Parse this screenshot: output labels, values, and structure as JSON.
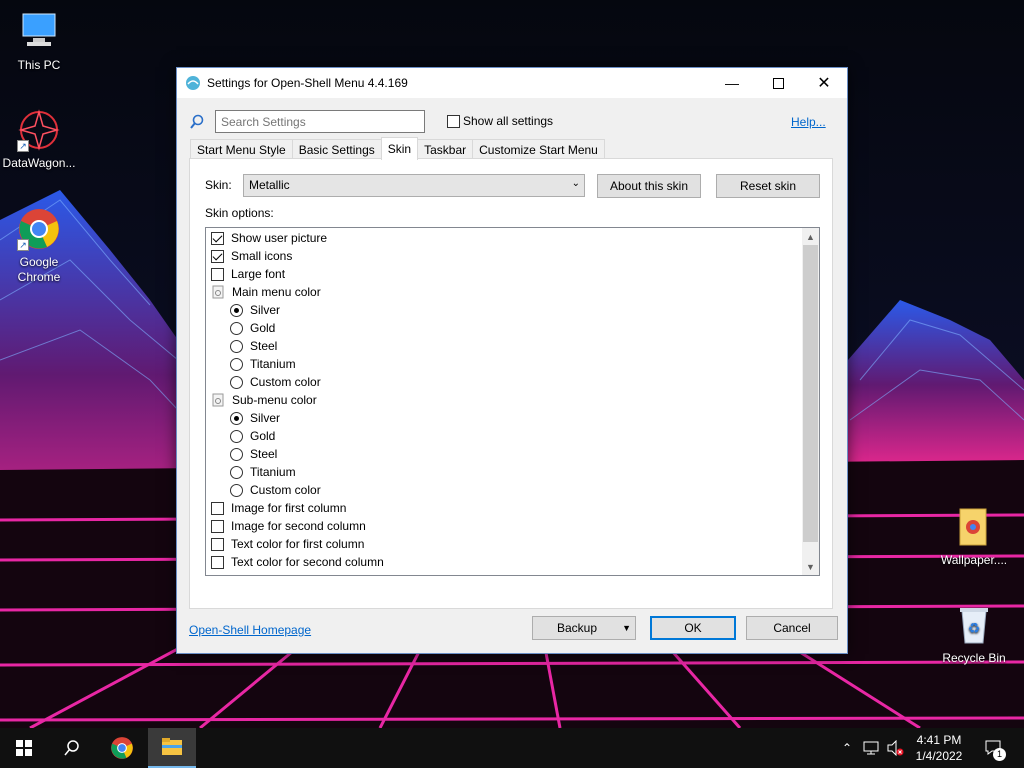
{
  "desktop": {
    "icons": [
      {
        "label": "This PC"
      },
      {
        "label": "DataWagon..."
      },
      {
        "label": "Google Chrome"
      },
      {
        "label": "Wallpaper...."
      },
      {
        "label": "Recycle Bin"
      }
    ]
  },
  "dialog": {
    "title": "Settings for Open-Shell Menu 4.4.169",
    "search_placeholder": "Search Settings",
    "show_all_label": "Show all settings",
    "show_all_checked": false,
    "help_link": "Help...",
    "tabs": [
      {
        "label": "Start Menu Style",
        "active": false
      },
      {
        "label": "Basic Settings",
        "active": false
      },
      {
        "label": "Skin",
        "active": true
      },
      {
        "label": "Taskbar",
        "active": false
      },
      {
        "label": "Customize Start Menu",
        "active": false
      }
    ],
    "skin_label": "Skin:",
    "skin_value": "Metallic",
    "about_skin_button": "About this skin",
    "reset_skin_button": "Reset skin",
    "skin_options_label": "Skin options:",
    "options": [
      {
        "type": "check",
        "label": "Show user picture",
        "checked": true
      },
      {
        "type": "check",
        "label": "Small icons",
        "checked": true
      },
      {
        "type": "check",
        "label": "Large font",
        "checked": false
      },
      {
        "type": "group",
        "label": "Main menu color"
      },
      {
        "type": "radio",
        "label": "Silver",
        "checked": true
      },
      {
        "type": "radio",
        "label": "Gold",
        "checked": false
      },
      {
        "type": "radio",
        "label": "Steel",
        "checked": false
      },
      {
        "type": "radio",
        "label": "Titanium",
        "checked": false
      },
      {
        "type": "radio",
        "label": "Custom color",
        "checked": false
      },
      {
        "type": "group",
        "label": "Sub-menu color"
      },
      {
        "type": "radio",
        "label": "Silver",
        "checked": true
      },
      {
        "type": "radio",
        "label": "Gold",
        "checked": false
      },
      {
        "type": "radio",
        "label": "Steel",
        "checked": false
      },
      {
        "type": "radio",
        "label": "Titanium",
        "checked": false
      },
      {
        "type": "radio",
        "label": "Custom color",
        "checked": false
      },
      {
        "type": "check",
        "label": "Image for first column",
        "checked": false
      },
      {
        "type": "check",
        "label": "Image for second column",
        "checked": false
      },
      {
        "type": "check",
        "label": "Text color for first column",
        "checked": false
      },
      {
        "type": "check",
        "label": "Text color for second column",
        "checked": false
      }
    ],
    "homepage_link": "Open-Shell Homepage",
    "backup_button": "Backup",
    "ok_button": "OK",
    "cancel_button": "Cancel"
  },
  "taskbar": {
    "time": "4:41 PM",
    "date": "1/4/2022",
    "notification_count": "1"
  },
  "colors": {
    "accent": "#0078d7",
    "link": "#0066cc",
    "grid_pink": "#ff2bb5",
    "mountain_blue": "#3b6fff"
  }
}
